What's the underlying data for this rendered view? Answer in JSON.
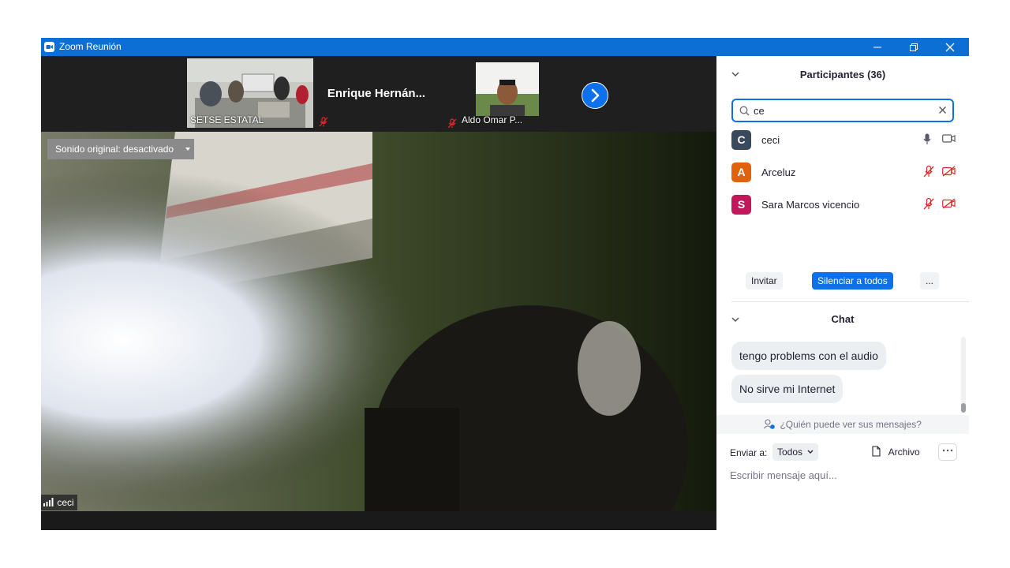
{
  "window": {
    "title": "Zoom Reunión"
  },
  "strip": {
    "thumbs": [
      {
        "name": "SETSE ESTATAL"
      },
      {
        "name": "Enrique  Hernán..."
      },
      {
        "name": "Aldo Omar P..."
      }
    ]
  },
  "main_video": {
    "audio_label": "Sonido original: desactivado",
    "speaker_name": "ceci"
  },
  "participants": {
    "title": "Participantes (36)",
    "search_value": "ce",
    "list": [
      {
        "initial": "C",
        "name": "ceci",
        "color": "#3a4a5e",
        "muted": false
      },
      {
        "initial": "A",
        "name": "Arceluz",
        "color": "#e0620d",
        "muted": true
      },
      {
        "initial": "S",
        "name": "Sara Marcos vicencio",
        "color": "#c2185b",
        "muted": true
      }
    ],
    "invite_label": "Invitar",
    "mute_all_label": "Silenciar a todos",
    "more_label": "..."
  },
  "chat": {
    "title": "Chat",
    "messages": [
      "tengo problems con el audio",
      "No sirve mi Internet"
    ],
    "who_can_see": "¿Quién puede ver sus mensajes?",
    "send_to_label": "Enviar a:",
    "send_to_value": "Todos",
    "file_label": "Archivo",
    "input_placeholder": "Escribir mensaje aquí..."
  },
  "colors": {
    "titlebar": "#0b6fd6",
    "accent": "#0e71eb",
    "muted_red": "#e02828"
  }
}
